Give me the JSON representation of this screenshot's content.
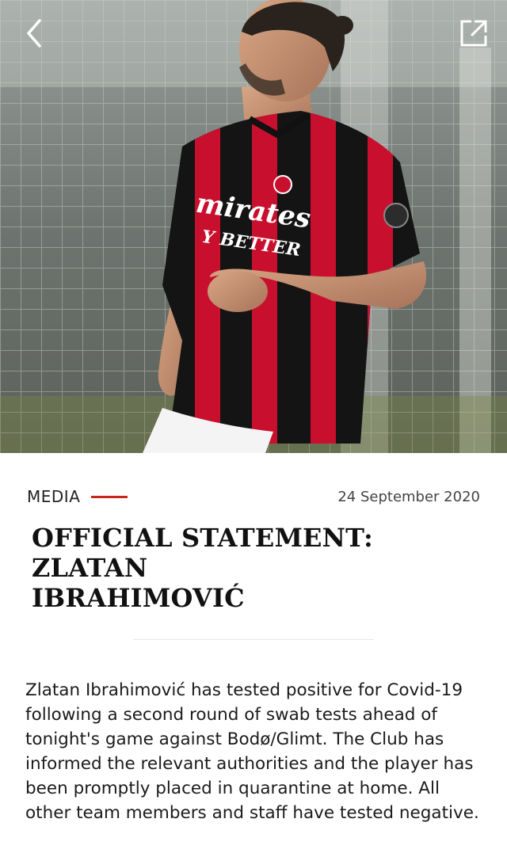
{
  "header": {
    "back_icon": "chevron-left-icon",
    "share_icon": "external-link-icon"
  },
  "hero": {
    "image_alt": "Player in red and black striped football shirt"
  },
  "article": {
    "category": "MEDIA",
    "date": "24 September 2020",
    "title_line1": "OFFICIAL STATEMENT: ZLATAN",
    "title_line2": "IBRAHIMOVIĆ",
    "body": "Zlatan Ibrahimović has tested positive for Covid-19 following a second round of swab tests ahead of tonight's game against Bodø/Glimt. The Club has informed the relevant authorities and the player has been promptly placed in quarantine at home. All other team members and staff have tested negative."
  },
  "colors": {
    "accent": "#c4281c",
    "kit_red": "#c8102e",
    "kit_black": "#141414"
  }
}
